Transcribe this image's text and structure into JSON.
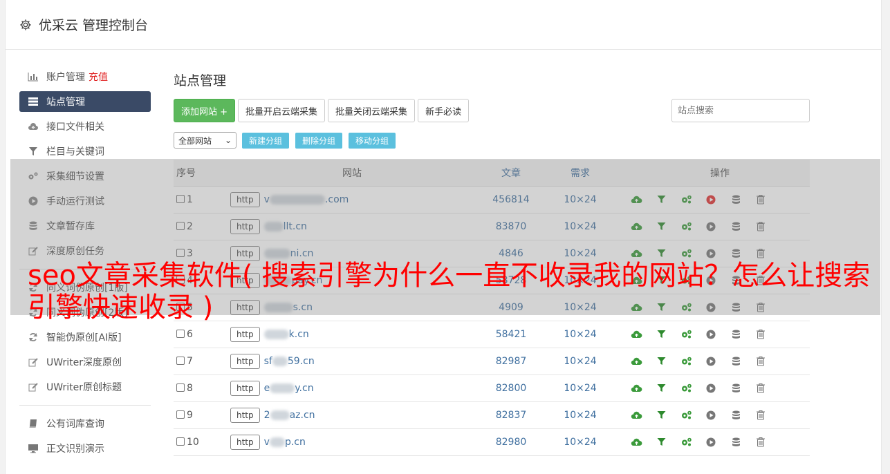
{
  "header": {
    "title": "优采云 管理控制台",
    "icon": "gear-icon"
  },
  "sidebar": {
    "items": [
      {
        "label": "账户管理",
        "extra": "充值",
        "icon": "bar-chart-icon"
      },
      {
        "label": "站点管理",
        "icon": "server-icon",
        "active": true
      },
      {
        "label": "接口文件相关",
        "icon": "cloud-upload-icon"
      },
      {
        "label": "栏目与关键词",
        "icon": "filter-icon"
      },
      {
        "label": "采集细节设置",
        "icon": "cogs-icon"
      },
      {
        "label": "手动运行测试",
        "icon": "play-circle-icon"
      },
      {
        "label": "文章暂存库",
        "icon": "database-icon"
      },
      {
        "label": "深度原创任务",
        "icon": "edit-icon"
      },
      {
        "label": "同义词伪原创[1版]",
        "icon": "refresh-icon"
      },
      {
        "label": "同义词伪原创[2版]",
        "icon": "refresh-icon"
      },
      {
        "label": "智能伪原创[AI版]",
        "icon": "refresh-icon"
      },
      {
        "label": "UWriter深度原创",
        "icon": "edit-icon"
      },
      {
        "label": "UWriter原创标题",
        "icon": "edit-icon"
      },
      {
        "label": "公有词库查询",
        "icon": "book-icon"
      },
      {
        "label": "正文识别演示",
        "icon": "monitor-icon"
      }
    ]
  },
  "main": {
    "title": "站点管理",
    "buttons": {
      "add": "添加网站 +",
      "batch_on": "批量开启云端采集",
      "batch_off": "批量关闭云端采集",
      "guide": "新手必读"
    },
    "search_placeholder": "站点搜索",
    "group_select": "全部网站",
    "group_buttons": {
      "new": "新建分组",
      "delete": "删除分组",
      "move": "移动分组"
    },
    "table": {
      "headers": {
        "num": "序号",
        "site": "网站",
        "articles": "文章",
        "req": "需求",
        "ops": "操作"
      },
      "http_label": "http",
      "rows": [
        {
          "num": "1",
          "domain": ".com",
          "articles": "456814",
          "req": "10×24",
          "play_red": true
        },
        {
          "num": "2",
          "domain": "llt.cn",
          "articles": "83870",
          "req": "10×24"
        },
        {
          "num": "3",
          "domain": "ni.cn",
          "articles": "4846",
          "req": "10×24"
        },
        {
          "num": "4",
          "domain": "pay.cn",
          "articles": "58728",
          "req": "10×24"
        },
        {
          "num": "5",
          "domain": "s.cn",
          "articles": "4909",
          "req": "10×24"
        },
        {
          "num": "6",
          "domain": "k.cn",
          "articles": "58421",
          "req": "10×24"
        },
        {
          "num": "7",
          "domain": "59.cn",
          "articles": "82987",
          "req": "10×24"
        },
        {
          "num": "8",
          "domain": "y.cn",
          "articles": "82800",
          "req": "10×24"
        },
        {
          "num": "9",
          "domain": "az.cn",
          "articles": "82837",
          "req": "10×24"
        },
        {
          "num": "10",
          "domain": "p.cn",
          "articles": "82980",
          "req": "10×24"
        }
      ]
    }
  },
  "overlay": {
    "text": "seo文章采集软件( 搜索引擎为什么一直不收录我的网站？怎么让搜索引擎快速收录 )"
  },
  "colors": {
    "active_nav": "#3a4a66",
    "add_button": "#5cb85c",
    "group_button": "#5bc0de",
    "link": "#3f6f9f",
    "overlay_text": "#ff0000"
  }
}
